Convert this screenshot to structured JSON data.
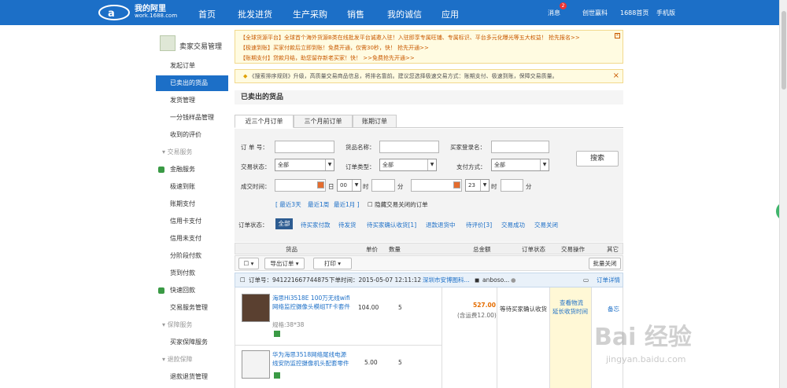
{
  "header": {
    "brand_title": "我的阿里",
    "brand_sub": "work.1688.com",
    "nav": [
      "首页",
      "批发进货",
      "生产采购",
      "销售",
      "我的诚信",
      "应用"
    ],
    "right": {
      "messages": "消息",
      "message_count": "2",
      "bank": "创世赢科",
      "home": "1688首页",
      "mobile": "手机版"
    }
  },
  "sidebar": {
    "title": "卖家交易管理",
    "items": [
      "发起订单",
      "已卖出的货品",
      "发货管理",
      "一分钱样品管理",
      "收到的评价"
    ],
    "group1": "交易服务",
    "group1_items": [
      "金融服务",
      "极速到账",
      "账期支付",
      "信用卡支付",
      "信用未支付",
      "分阶段付款",
      "货到付款",
      "快速回款",
      "交易服务管理"
    ],
    "group2": "保障服务",
    "group2_items": [
      "买家保障服务"
    ],
    "group3": "退款保障",
    "group3_items": [
      "退款退货管理"
    ]
  },
  "notices": {
    "line1": "【全球货源平台】全球首个海外货源B类在线批发平台诚邀入驻！入驻即享专属旺铺、专属标识、平台多元化曝光等五大权益！ 抢先报名>>",
    "line2": "【极速到账】买家付款后立即到账！免费开通，仅需30秒，快！ 抢先开通>>",
    "line3": "【账期支付】贷款月结，助您留存新老买家！快！ >>免费抢先开通>>",
    "line4": "《搜索排序规则》升级，高质量交易商品信息，将排名靠前。建议您选择极速交易方式：账期支付、极速到账，保障交易质量。"
  },
  "page_title": "已卖出的货品",
  "tabs": [
    "近三个月订单",
    "三个月前订单",
    "账期订单"
  ],
  "filter": {
    "order_no": "订 单 号：",
    "product_name": "货品名称：",
    "buyer_login": "买家登录名：",
    "trade_status": "交易状态：",
    "order_type": "订单类型：",
    "pay_method": "支付方式：",
    "all": "全部",
    "deal_time": "成交时间：",
    "day": "日",
    "hour": "时",
    "minute": "分",
    "hour_start": "00",
    "hour_end": "23",
    "search": "搜索",
    "quick": [
      "[ 最近3天",
      "最近1周",
      "最近1月 ]"
    ],
    "hide_closed": "隐藏交易关闭的订单",
    "status_label": "订单状态：",
    "statuses": [
      "全部",
      "待买家付款",
      "待发货",
      "待买家确认收货[1]",
      "退款退货中",
      "待评价[3]",
      "交易成功",
      "交易关闭"
    ]
  },
  "table": {
    "headers": [
      "货品",
      "单价",
      "数量",
      "总金额",
      "订单状态",
      "交易操作",
      "其它"
    ],
    "export": "导出订单",
    "print": "打印",
    "batch_close": "批量关闭",
    "order_no": "订单号：941221667744875",
    "order_time": "下单时间：2015-05-07 12:11:12",
    "buyer": "深圳市安博图科...",
    "buyer2": "anboso...",
    "detail": "订单详情",
    "items": [
      {
        "name": "海思Hi3518E 100万无线wifi网络监控摄像头模组TF卡套件",
        "spec": "规格:38*38",
        "price": "104.00",
        "qty": "5"
      },
      {
        "name": "华为海思3518网络尾线电源线安防监控摄像机头配套零件",
        "spec": "",
        "price": "5.00",
        "qty": "5"
      }
    ],
    "total": "527.00",
    "shipping": "(含运费12.00)",
    "status": "等待买家确认收货",
    "action1": "查看物流",
    "action2": "延长收货时间",
    "other": "备忘"
  },
  "watermark": {
    "text": "Bai 经验",
    "url": "jingyan.baidu.com"
  }
}
